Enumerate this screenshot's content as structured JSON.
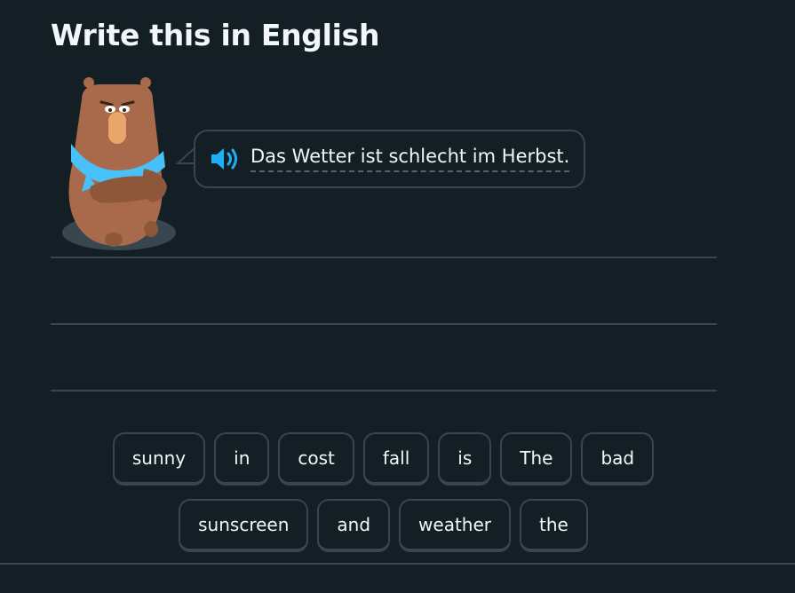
{
  "header": {
    "title": "Write this in English"
  },
  "prompt": {
    "text": "Das Wetter ist schlecht im Herbst.",
    "speaker_icon": "speaker-icon"
  },
  "mascot": {
    "icon": "bear-mascot"
  },
  "word_bank": {
    "row1": [
      "sunny",
      "in",
      "cost",
      "fall",
      "is",
      "The",
      "bad"
    ],
    "row2": [
      "sunscreen",
      "and",
      "weather",
      "the"
    ]
  },
  "colors": {
    "background": "#131f24",
    "border": "#37464f",
    "text": "#f1f7fb",
    "speaker": "#1cb0f6",
    "bear": "#a86a4a",
    "scarf": "#49c0f8"
  }
}
